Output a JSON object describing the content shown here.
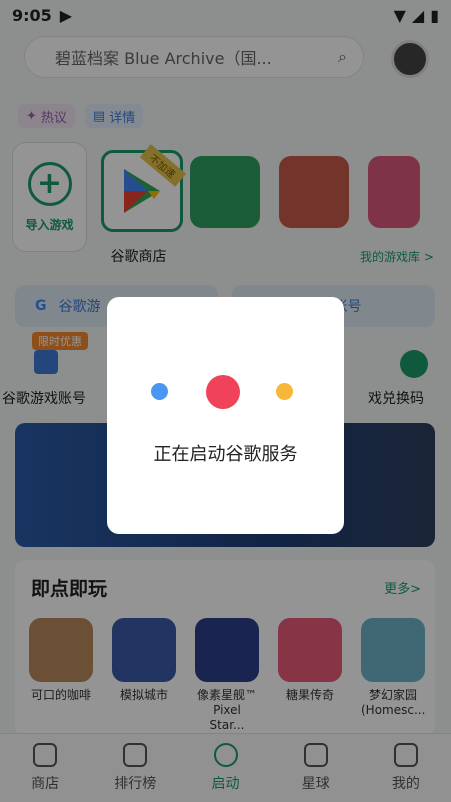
{
  "status_bar": {
    "time": "9:05"
  },
  "search": {
    "placeholder": "碧蓝档案 Blue Archive（国..."
  },
  "chips": {
    "hot": "热议",
    "detail": "详情"
  },
  "games": {
    "import_label": "导入游戏",
    "store_label": "谷歌商店",
    "fast_tag": "不加速",
    "library_link": "我的游戏库 >"
  },
  "features": {
    "google_btn": "谷歌游",
    "account_btn": "谷歌账号",
    "promo_tag": "限时优惠",
    "item1_label": "谷歌游戏账号",
    "item2_label": "戏兑换码"
  },
  "instant": {
    "title": "即点即玩",
    "more": "更多>",
    "games": [
      {
        "name": "可口的咖啡",
        "color": "#b88a5c"
      },
      {
        "name": "模拟城市",
        "color": "#3b5aa8"
      },
      {
        "name": "像素星舰™ Pixel Star...",
        "color": "#2c3f8a"
      },
      {
        "name": "糖果传奇",
        "color": "#e85a7a"
      },
      {
        "name": "梦幻家园 (Homesc...",
        "color": "#6fb3c9"
      }
    ]
  },
  "nav": {
    "items": [
      {
        "label": "商店",
        "icon": "store-icon"
      },
      {
        "label": "排行榜",
        "icon": "chart-icon"
      },
      {
        "label": "启动",
        "icon": "play-icon"
      },
      {
        "label": "星球",
        "icon": "planet-icon"
      },
      {
        "label": "我的",
        "icon": "profile-icon"
      }
    ],
    "active": "启动"
  },
  "dialog": {
    "message": "正在启动谷歌服务"
  }
}
